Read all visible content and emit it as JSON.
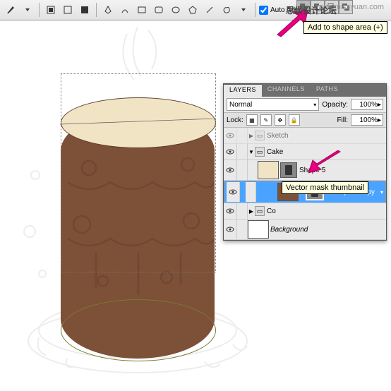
{
  "toolbar": {
    "auto_add_delete": "Auto Add/Delete",
    "tooltip_add_shape": "Add to shape area (+)"
  },
  "watermark": "www.missyuan.com",
  "overlay_text": "思缘设计论坛",
  "panel": {
    "tabs": [
      "LAYERS",
      "CHANNELS",
      "PATHS"
    ],
    "blend_mode": "Normal",
    "opacity_label": "Opacity:",
    "opacity_value": "100%",
    "lock_label": "Lock:",
    "fill_label": "Fill:",
    "fill_value": "100%",
    "layers": {
      "sketch": "Sketch",
      "cake": "Cake",
      "shape5": "Shape 5",
      "shape5copy": "Shape 5 copy",
      "co": "Co",
      "background": "Background"
    },
    "tooltip_mask": "Vector mask thumbnail"
  }
}
